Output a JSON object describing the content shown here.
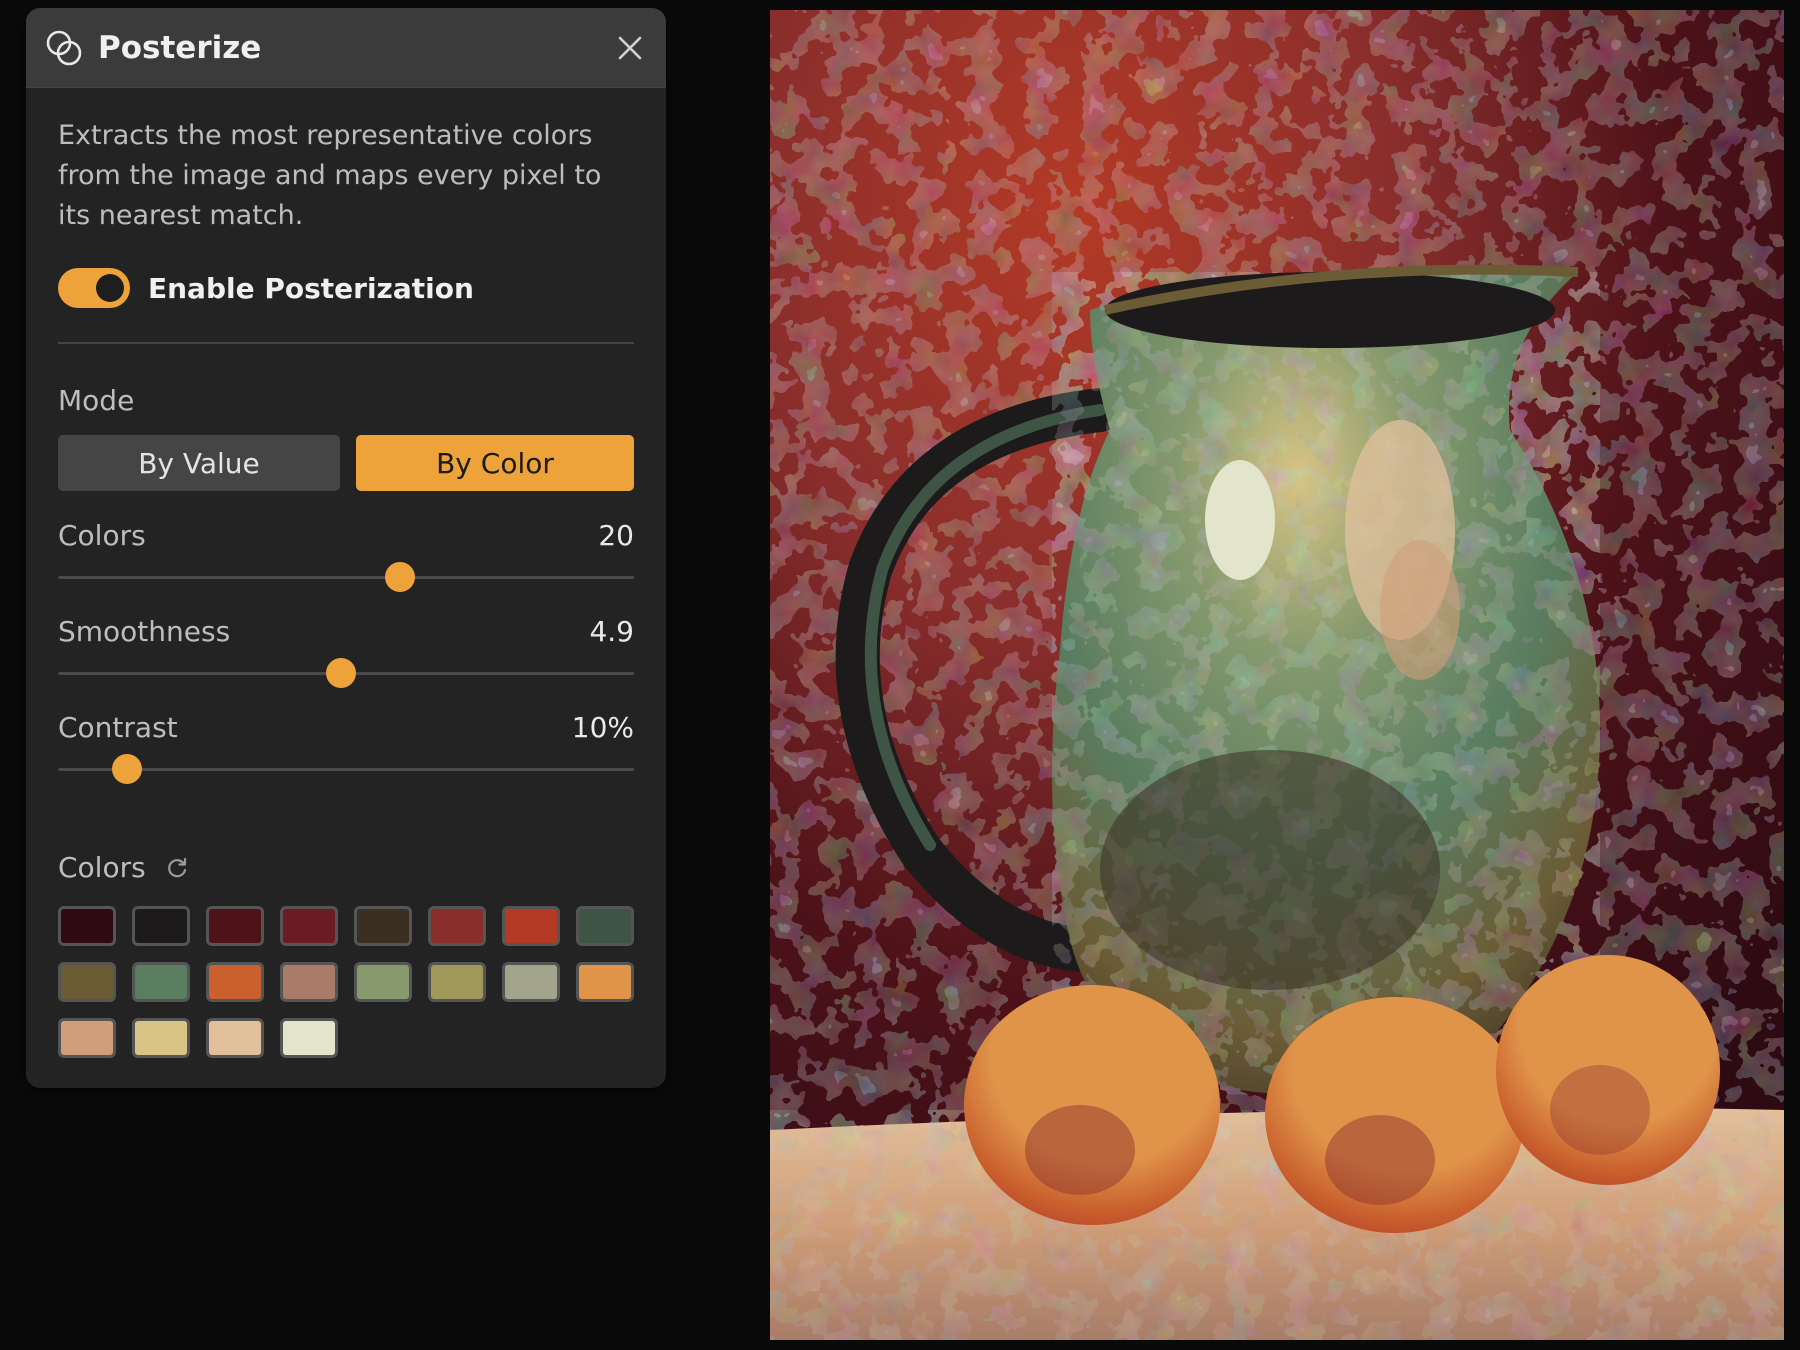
{
  "panel": {
    "title": "Posterize",
    "icon": "overlapping-circles-icon",
    "close_icon": "close-icon",
    "description": "Extracts the most representative colors from the image and maps every pixel to its nearest match.",
    "toggle": {
      "label": "Enable Posterization",
      "on": true
    },
    "mode": {
      "label": "Mode",
      "options": [
        "By Value",
        "By Color"
      ],
      "selected": "By Color"
    },
    "sliders": [
      {
        "label": "Colors",
        "value": "20",
        "fraction": 0.594
      },
      {
        "label": "Smoothness",
        "value": "4.9",
        "fraction": 0.491
      },
      {
        "label": "Contrast",
        "value": "10%",
        "fraction": 0.12
      }
    ],
    "palette": {
      "label": "Colors",
      "refresh_icon": "refresh-icon",
      "colors": [
        "#2e0a12",
        "#1c1a1b",
        "#4e1219",
        "#6a1b24",
        "#3a2f22",
        "#8a2e2c",
        "#b43a26",
        "#3e5444",
        "#6b5c36",
        "#5a7d60",
        "#c9602e",
        "#a87c68",
        "#879a6e",
        "#a09858",
        "#a2a48c",
        "#e0944a",
        "#d09e78",
        "#d8c484",
        "#e2c09c",
        "#e2e4cc"
      ]
    }
  },
  "colors": {
    "accent": "#eda23a",
    "panel_bg": "#232323",
    "header_bg": "#3b3b3b",
    "app_bg": "#0a0a0a"
  }
}
